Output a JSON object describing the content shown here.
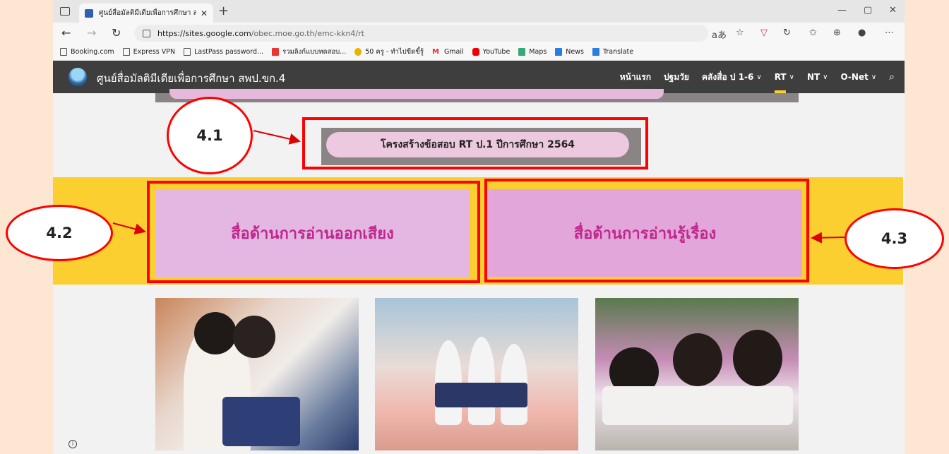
{
  "browser": {
    "tab_title": "ศูนย์สื่อมัลติมีเดียเพื่อการศึกษา สพป.ข",
    "url_host": "https://sites.google.com",
    "url_path": "/obec.moe.go.th/emc-kkn4/rt",
    "bookmarks": [
      {
        "label": "Booking.com",
        "icon": "page-icon"
      },
      {
        "label": "Express VPN",
        "icon": "page-icon"
      },
      {
        "label": "LastPass password...",
        "icon": "page-icon"
      },
      {
        "label": "รวมลิงก์แบบทดสอบ...",
        "icon": "calendar-icon"
      },
      {
        "label": "50 ครู - ทำไปขีดขี้รู้",
        "icon": "coin-icon"
      },
      {
        "label": "Gmail",
        "icon": "gmail-icon"
      },
      {
        "label": "YouTube",
        "icon": "youtube-icon"
      },
      {
        "label": "Maps",
        "icon": "maps-icon"
      },
      {
        "label": "News",
        "icon": "news-icon"
      },
      {
        "label": "Translate",
        "icon": "translate-icon"
      }
    ]
  },
  "site": {
    "title": "ศูนย์สื่อมัลติมีเดียเพื่อการศึกษา สพป.ขก.4",
    "nav": [
      {
        "label": "หน้าแรก",
        "dropdown": false
      },
      {
        "label": "ปฐมวัย",
        "dropdown": false
      },
      {
        "label": "คลังสื่อ ป 1-6",
        "dropdown": true
      },
      {
        "label": "RT",
        "dropdown": true,
        "active": true
      },
      {
        "label": "NT",
        "dropdown": true
      },
      {
        "label": "O-Net",
        "dropdown": true
      }
    ]
  },
  "content": {
    "rt_structure_button": "โครงสร้างข้อสอบ RT ป.1 ปีการศึกษา 2564",
    "card_left": "สื่อด้านการอ่านออกเสียง",
    "card_right": "สื่อด้านการอ่านรู้เรื่อง"
  },
  "annotations": {
    "label_41": "4.1",
    "label_42": "4.2",
    "label_43": "4.3"
  },
  "colors": {
    "header_bg": "#3e3e3e",
    "accent_yellow": "#fbcf2f",
    "annotation_red": "#ff0000",
    "card_text": "#c0288e"
  }
}
